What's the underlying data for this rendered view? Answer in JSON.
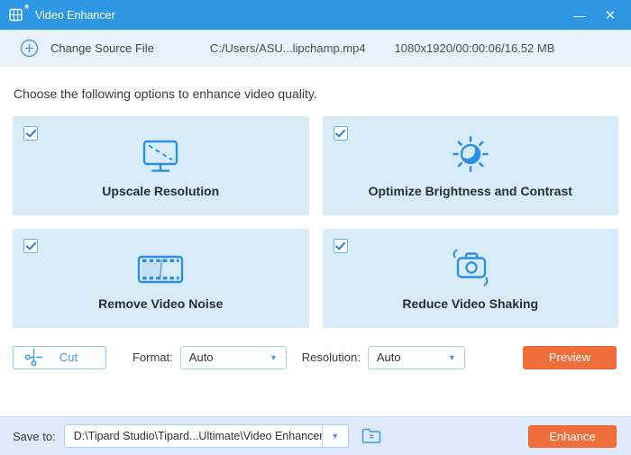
{
  "titlebar": {
    "title": "Video Enhancer"
  },
  "icons": {
    "app_badge": "*",
    "minimize": "—",
    "close": "✕",
    "dropdown_arrow": "▼"
  },
  "source_bar": {
    "change_label": "Change Source File",
    "file_path": "C:/Users/ASU...lipchamp.mp4",
    "file_info": "1080x1920/00:00:06/16.52 MB"
  },
  "main": {
    "heading": "Choose the following options to enhance video quality.",
    "options": [
      {
        "label": "Upscale Resolution",
        "icon": "monitor-icon",
        "checked": true
      },
      {
        "label": "Optimize Brightness and Contrast",
        "icon": "brightness-icon",
        "checked": true
      },
      {
        "label": "Remove Video Noise",
        "icon": "film-strip-icon",
        "checked": true
      },
      {
        "label": "Reduce Video Shaking",
        "icon": "camera-icon",
        "checked": true
      }
    ]
  },
  "toolbar": {
    "cut_label": "Cut",
    "format_label": "Format:",
    "format_value": "Auto",
    "resolution_label": "Resolution:",
    "resolution_value": "Auto",
    "preview_label": "Preview"
  },
  "footer": {
    "save_to_label": "Save to:",
    "save_path": "D:\\Tipard Studio\\Tipard...Ultimate\\Video Enhancer",
    "enhance_label": "Enhance"
  },
  "colors": {
    "titlebar_bg": "#2e97e3",
    "source_bar_bg": "#e9f2fb",
    "card_bg": "#d8ecf8",
    "accent_blue": "#2e8fe0",
    "action_orange": "#f06e3c",
    "footer_bg": "#dfeafa"
  }
}
